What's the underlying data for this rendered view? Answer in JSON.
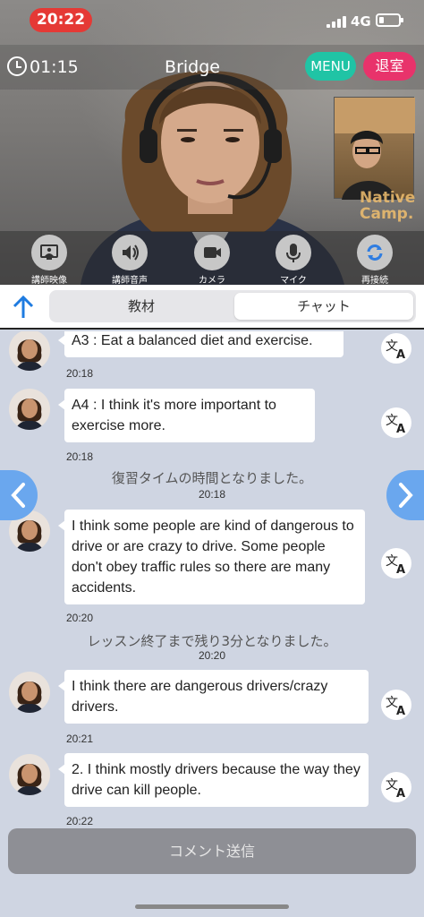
{
  "status": {
    "time": "20:22",
    "network": "4G"
  },
  "header": {
    "timer": "01:15",
    "title": "Bridge",
    "menu_label": "MENU",
    "exit_label": "退室",
    "watermark": "Native Camp."
  },
  "controls": [
    {
      "label": "講師映像",
      "icon": "screen-icon"
    },
    {
      "label": "講師音声",
      "icon": "speaker-icon"
    },
    {
      "label": "カメラ",
      "icon": "camera-icon"
    },
    {
      "label": "マイク",
      "icon": "microphone-icon"
    },
    {
      "label": "再接続",
      "icon": "refresh-icon"
    }
  ],
  "tabs": {
    "material": "教材",
    "chat": "チャット",
    "active": "chat"
  },
  "chat": {
    "messages": [
      {
        "text": "A3 : Eat a balanced diet and exercise.",
        "time": "20:18"
      },
      {
        "text": "A4 : I think it's more important to exercise more.",
        "time": "20:18"
      },
      {
        "text": "I think some people are kind of dangerous to drive or are crazy to drive. Some people don't obey traffic rules so there are many accidents.",
        "time": "20:20"
      },
      {
        "text": "I think there are dangerous drivers/crazy drivers.",
        "time": "20:21"
      },
      {
        "text": "2. I think mostly drivers because the way they drive can kill people.",
        "time": "20:22"
      }
    ],
    "system": [
      {
        "text": "復習タイムの時間となりました。",
        "time": "20:18"
      },
      {
        "text": "レッスン終了まで残り3分となりました。",
        "time": "20:20"
      }
    ]
  },
  "footer": {
    "send_label": "コメント送信"
  },
  "colors": {
    "menu": "#20c4a5",
    "exit": "#e8336b",
    "status_pill": "#e53935",
    "nav_arrow": "#6aa7ee",
    "chat_bg": "#cfd5e2",
    "send_button": "#8e8f95"
  }
}
